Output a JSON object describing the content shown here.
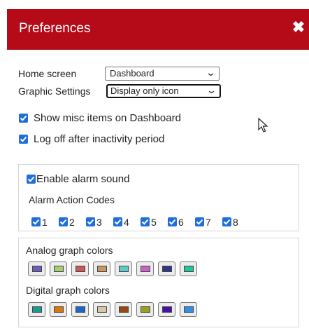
{
  "dialog": {
    "title": "Preferences",
    "close_glyph": "✖"
  },
  "home_screen": {
    "label": "Home screen",
    "value": "Dashboard"
  },
  "graphic_settings": {
    "label": "Graphic Settings",
    "value": "Display only icon"
  },
  "options": {
    "show_misc": {
      "label": "Show misc items on Dashboard",
      "checked": true
    },
    "log_off": {
      "label": "Log off after inactivity period",
      "checked": true
    }
  },
  "alarm": {
    "enable_label": "Enable alarm sound",
    "enabled": true,
    "codes_label": "Alarm Action Codes",
    "codes": [
      "1",
      "2",
      "3",
      "4",
      "5",
      "6",
      "7",
      "8"
    ]
  },
  "graph_colors": {
    "analog_label": "Analog graph colors",
    "analog": [
      "#6a5fb8",
      "#a4cf70",
      "#c6585e",
      "#c99563",
      "#5ec9c7",
      "#c862c6",
      "#2b3787",
      "#22c49a"
    ],
    "digital_label": "Digital graph colors",
    "digital": [
      "#1a9a92",
      "#d7780e",
      "#1a67c6",
      "#d9c6a3",
      "#98480f",
      "#9aa21b",
      "#4a0fa6",
      "#2f8fe6"
    ]
  },
  "accent_color": "#b50b18",
  "checkbox_color": "#1e6fd9"
}
